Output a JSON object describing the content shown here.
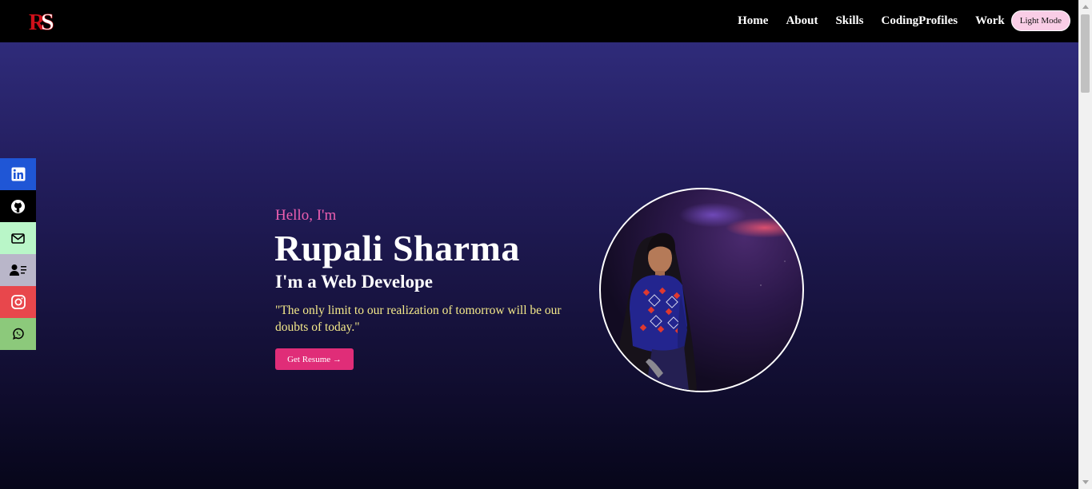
{
  "nav": {
    "logo_alt": "RS",
    "links": [
      "Home",
      "About",
      "Skills",
      "CodingProfiles",
      "Work"
    ],
    "mode_button": "Light Mode"
  },
  "social": [
    {
      "name": "linkedin",
      "icon": "linkedin-icon",
      "color": "#1f56d6"
    },
    {
      "name": "github",
      "icon": "github-icon",
      "color": "#000000"
    },
    {
      "name": "email",
      "icon": "mail-icon",
      "color": "#b9f6c8"
    },
    {
      "name": "contact",
      "icon": "contact-card-icon",
      "color": "#b9b6c9"
    },
    {
      "name": "instagram",
      "icon": "instagram-icon",
      "color": "#e8474c"
    },
    {
      "name": "whatsapp",
      "icon": "whatsapp-icon",
      "color": "#8cc97b"
    }
  ],
  "hero": {
    "greeting": "Hello, I'm",
    "name": "Rupali Sharma",
    "role": "I'm a Web Develope",
    "quote": "\"The only limit to our realization of tomorrow will be our doubts of today.\"",
    "resume_button": "Get Resume →"
  },
  "colors": {
    "accent_pink": "#e02d78",
    "greeting": "#ee5fb0",
    "quote": "#f4e98a"
  }
}
